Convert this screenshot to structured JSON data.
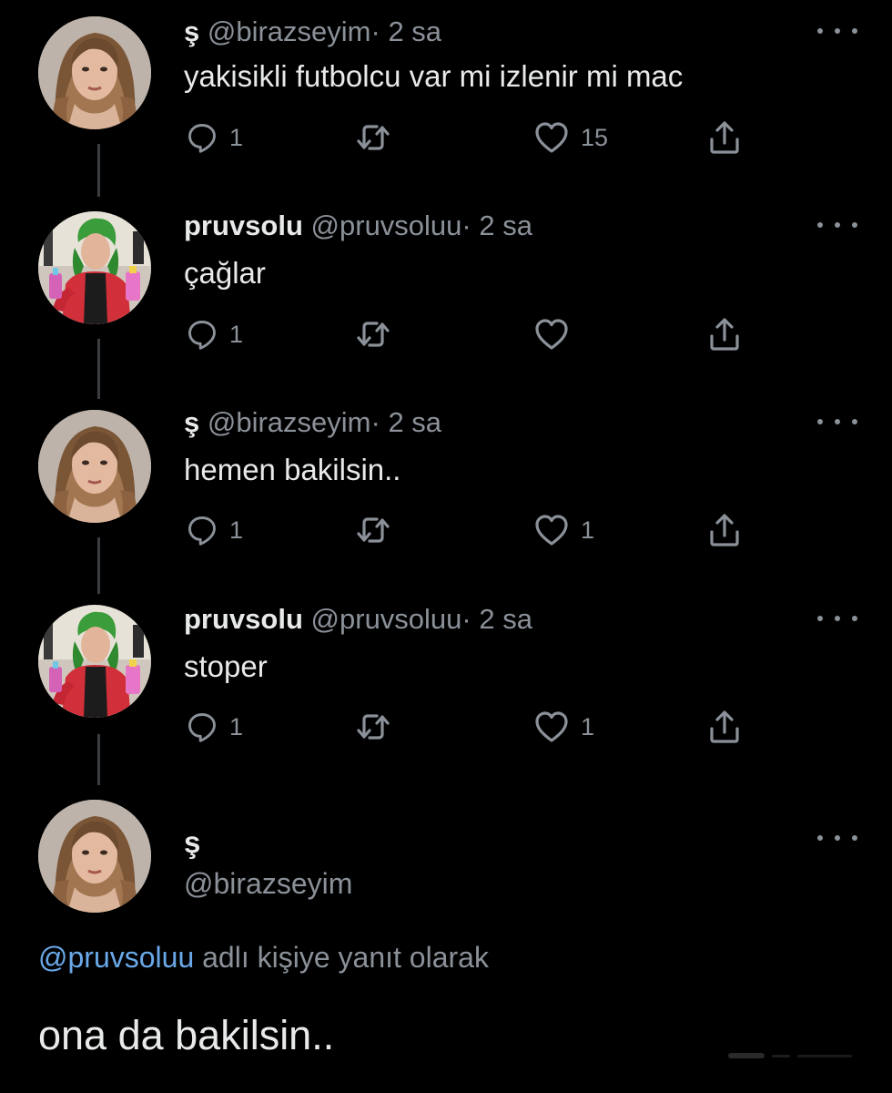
{
  "tweets": [
    {
      "name": "ş",
      "handle": "@birazseyim",
      "dot": "·",
      "time": "2 sa",
      "text": "yakisikli futbolcu var mi izlenir mi mac",
      "reply_count": "1",
      "like_count": "15"
    },
    {
      "name": "pruvsolu",
      "handle": "@pruvsoluu",
      "dot": "·",
      "time": "2 sa",
      "text": "çağlar",
      "reply_count": "1",
      "like_count": ""
    },
    {
      "name": "ş",
      "handle": "@birazseyim",
      "dot": "·",
      "time": "2 sa",
      "text": "hemen bakilsin..",
      "reply_count": "1",
      "like_count": "1"
    },
    {
      "name": "pruvsolu",
      "handle": "@pruvsoluu",
      "dot": "·",
      "time": "2 sa",
      "text": "stoper",
      "reply_count": "1",
      "like_count": "1"
    }
  ],
  "main_tweet": {
    "name": "ş",
    "handle": "@birazseyim",
    "reply_mention": "@pruvsoluu",
    "reply_suffix": " adlı kişiye yanıt olarak",
    "text": "ona da bakilsin.."
  },
  "colors": {
    "background": "#000000",
    "text": "#e7e9ea",
    "secondary": "#8b9199",
    "link": "#6aa9e9"
  },
  "icons": {
    "reply": "reply-icon",
    "retweet": "retweet-icon",
    "like": "heart-icon",
    "share": "share-icon",
    "more": "more-icon"
  }
}
